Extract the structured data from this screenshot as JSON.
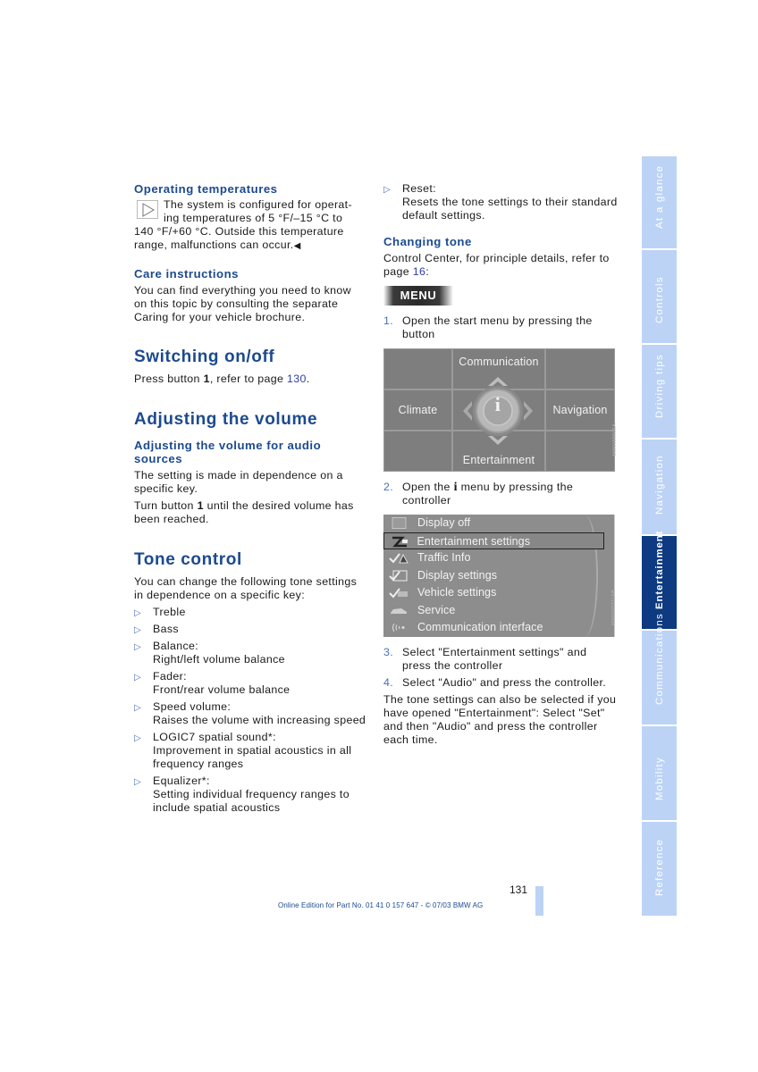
{
  "left_column": {
    "operating_temps": {
      "heading": "Operating temperatures",
      "text_line1": "The system is configured for operat-",
      "text_line2": "ing temperatures of 5 °F/–15 °C to",
      "text_rest": "140 °F/+60 °C. Outside this temperature range, malfunctions can occur.",
      "end_mark": "◀",
      "note_icon": "note-triangle-icon"
    },
    "care": {
      "heading": "Care instructions",
      "text": "You can find everything you need to know on this topic by consulting the separate Caring for your vehicle brochure."
    },
    "switching": {
      "heading": "Switching on/off",
      "text_before": "Press button ",
      "button_no": "1",
      "text_middle": ", refer to page ",
      "page_link": "130",
      "text_after": "."
    },
    "volume": {
      "heading": "Adjusting the volume",
      "subheading": "Adjusting the volume for audio sources",
      "para1": "The setting is made in dependence on a specific key.",
      "para2_before": "Turn button ",
      "para2_button": "1",
      "para2_after": " until the desired volume has been reached."
    },
    "tone": {
      "heading": "Tone control",
      "intro": "You can change the following tone settings in dependence on a specific key:",
      "bullet_icon": "▷",
      "items": [
        {
          "title": "Treble",
          "desc": ""
        },
        {
          "title": "Bass",
          "desc": ""
        },
        {
          "title": "Balance:",
          "desc": "Right/left volume balance"
        },
        {
          "title": "Fader:",
          "desc": "Front/rear volume balance"
        },
        {
          "title": "Speed volume:",
          "desc": "Raises the volume with increasing speed"
        },
        {
          "title": "LOGIC7 spatial sound*:",
          "desc": "Improvement in spatial acoustics in all frequency ranges"
        },
        {
          "title": "Equalizer*:",
          "desc": "Setting individual frequency ranges to include spatial acoustics"
        }
      ]
    }
  },
  "right_column": {
    "reset": {
      "title": "Reset:",
      "desc": "Resets the tone settings to their standard default settings."
    },
    "changing_tone": {
      "heading": "Changing tone",
      "text_before": "Control Center, for principle details, refer to page ",
      "page_link": "16",
      "text_after": ":",
      "menu_button": "MENU"
    },
    "steps": [
      {
        "num": "1.",
        "text": "Open the start menu by pressing the button"
      },
      {
        "num": "2.",
        "text_before": "Open the ",
        "icon": "i",
        "text_after": " menu by pressing the controller"
      },
      {
        "num": "3.",
        "text": "Select \"Entertainment settings\" and press the controller"
      },
      {
        "num": "4.",
        "text": "Select \"Audio\" and press the controller."
      }
    ],
    "start_menu_screen": {
      "top": "Communication",
      "left": "Climate",
      "right": "Navigation",
      "bottom": "Entertainment",
      "center_icon": "i",
      "ref_code": "MW00555LEA"
    },
    "info_menu_screen": {
      "items": [
        {
          "label": "Display off",
          "icon": "display-off-icon",
          "selected": false
        },
        {
          "label": "Entertainment settings",
          "icon": "entertainment-settings-icon",
          "selected": true
        },
        {
          "label": "Traffic Info",
          "icon": "traffic-info-icon",
          "selected": false
        },
        {
          "label": "Display settings",
          "icon": "display-settings-icon",
          "selected": false
        },
        {
          "label": "Vehicle settings",
          "icon": "vehicle-settings-icon",
          "selected": false
        },
        {
          "label": "Service",
          "icon": "service-car-icon",
          "selected": false
        },
        {
          "label": "Communication interface",
          "icon": "communication-interface-icon",
          "selected": false
        }
      ],
      "ref_code": "MW0055T1LEB"
    },
    "closing": "The tone settings can also be selected if you have opened \"Entertainment\": Select \"Set\" and then \"Audio\" and press the controller each time."
  },
  "side_tabs": [
    {
      "label": "At a glance",
      "active": false
    },
    {
      "label": "Controls",
      "active": false
    },
    {
      "label": "Driving tips",
      "active": false
    },
    {
      "label": "Navigation",
      "active": false
    },
    {
      "label": "Entertainment",
      "active": true
    },
    {
      "label": "Communications",
      "active": false
    },
    {
      "label": "Mobility",
      "active": false
    },
    {
      "label": "Reference",
      "active": false
    }
  ],
  "colors": {
    "heading_blue": "#1c4a8f",
    "tab_light": "#bcd3f5",
    "tab_active": "#0d3a80",
    "link": "#2d3ea8"
  },
  "page_number": "131",
  "footer": "Online Edition for Part No. 01 41 0 157 647 - © 07/03 BMW AG"
}
